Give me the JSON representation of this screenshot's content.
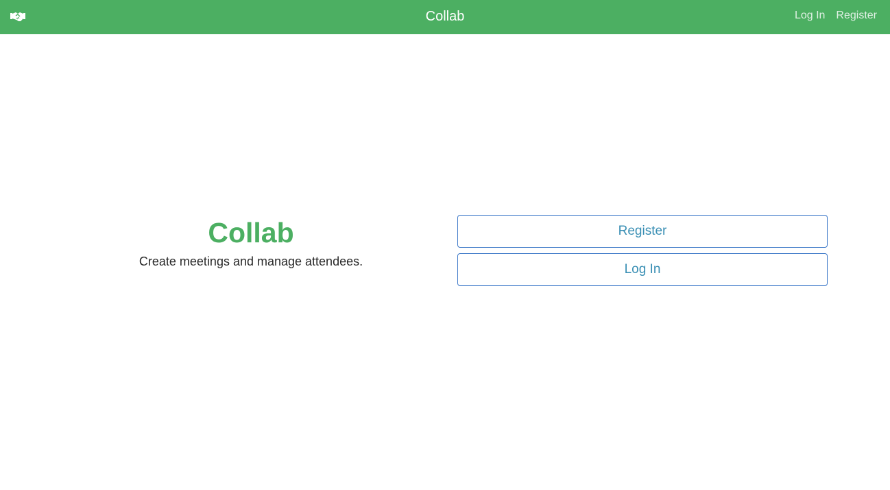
{
  "navbar": {
    "brand_icon": "handshake-icon",
    "title": "Collab",
    "links": [
      {
        "label": "Log In"
      },
      {
        "label": "Register"
      }
    ],
    "background_color": "#4caf62"
  },
  "hero": {
    "title": "Collab",
    "subtitle": "Create meetings and manage attendees.",
    "title_color": "#4caf62"
  },
  "actions": {
    "register_label": "Register",
    "login_label": "Log In",
    "button_border_color": "#3c78c8",
    "button_text_color": "#3a8fb4"
  }
}
